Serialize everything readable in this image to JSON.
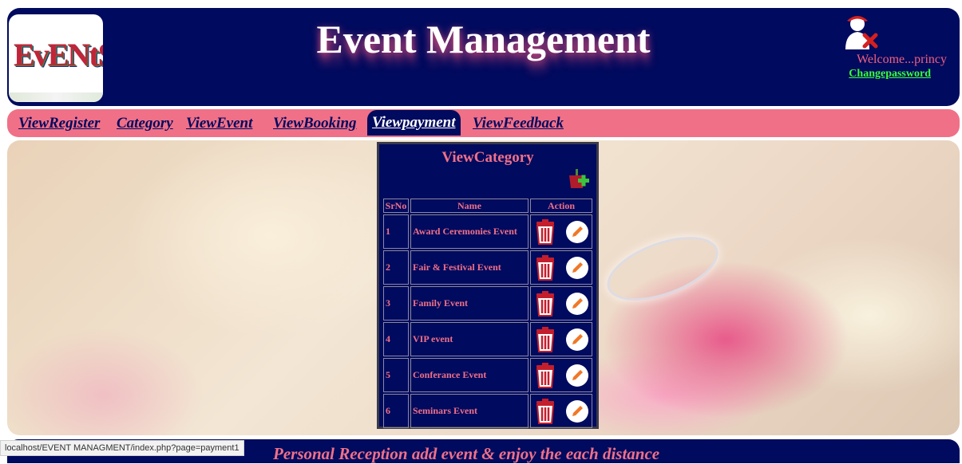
{
  "header": {
    "logo_text": "EvENtS",
    "title": "Event Management",
    "welcome": "Welcome...princy",
    "change_password": "Changepassword"
  },
  "nav": {
    "items": [
      {
        "label": "ViewRegister"
      },
      {
        "label": "Category"
      },
      {
        "label": "ViewEvent"
      },
      {
        "label": "ViewBooking"
      },
      {
        "label": "Viewpayment",
        "active": true
      },
      {
        "label": "ViewFeedback"
      }
    ]
  },
  "panel": {
    "title": "ViewCategory",
    "columns": [
      "SrNo",
      "Name",
      "Action"
    ],
    "rows": [
      {
        "srno": "1",
        "name": "Award Ceremonies Event"
      },
      {
        "srno": "2",
        "name": "Fair & Festival Event"
      },
      {
        "srno": "3",
        "name": "Family Event"
      },
      {
        "srno": "4",
        "name": "VIP event"
      },
      {
        "srno": "5",
        "name": "Conferance Event"
      },
      {
        "srno": "6",
        "name": "Seminars Event"
      }
    ],
    "icons": {
      "add": "add-category-icon",
      "delete": "trash-icon",
      "edit": "pencil-icon"
    }
  },
  "footer": {
    "text": "Personal Reception add event & enjoy the each distance"
  },
  "statusbar": {
    "url": "localhost/EVENT MANAGMENT/index.php?page=payment1"
  },
  "colors": {
    "navy": "#000a5e",
    "pink": "#f07088",
    "green_link": "#3aff3a"
  }
}
